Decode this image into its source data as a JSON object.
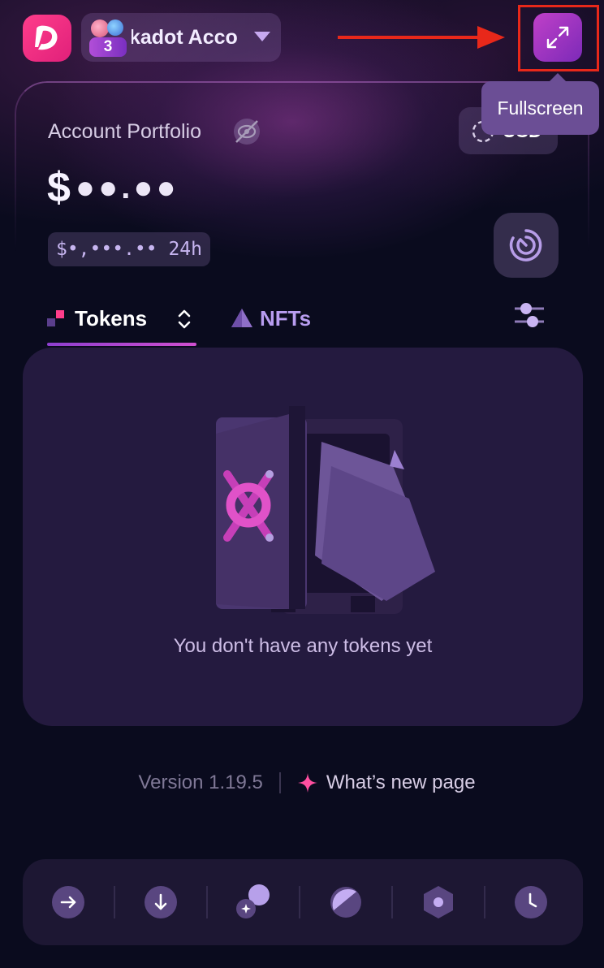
{
  "header": {
    "account_name": "lkadot Acco",
    "account_count": "3",
    "fullscreen_tooltip": "Fullscreen"
  },
  "portfolio": {
    "title": "Account Portfolio",
    "currency": "USD",
    "balance_symbol": "$",
    "balance_masked": "●●.●●",
    "change_masked": "$•,•••.•• 24h"
  },
  "tabs": {
    "tokens": "Tokens",
    "nfts": "NFTs"
  },
  "empty_state": {
    "message": "You don't have any tokens yet"
  },
  "footer": {
    "version": "Version 1.19.5",
    "whats_new": "What’s new page"
  },
  "bottom_nav": [
    {
      "icon": "send-arrow-icon"
    },
    {
      "icon": "receive-arrow-icon"
    },
    {
      "icon": "swap-icon"
    },
    {
      "icon": "staking-icon"
    },
    {
      "icon": "dapps-icon"
    },
    {
      "icon": "history-clock-icon"
    }
  ],
  "colors": {
    "background": "#0a0b1e",
    "accent_pink": "#e0207a",
    "accent_purple": "#8e3fd0",
    "tooltip": "#6b4e95",
    "highlight": "#e8281a"
  }
}
